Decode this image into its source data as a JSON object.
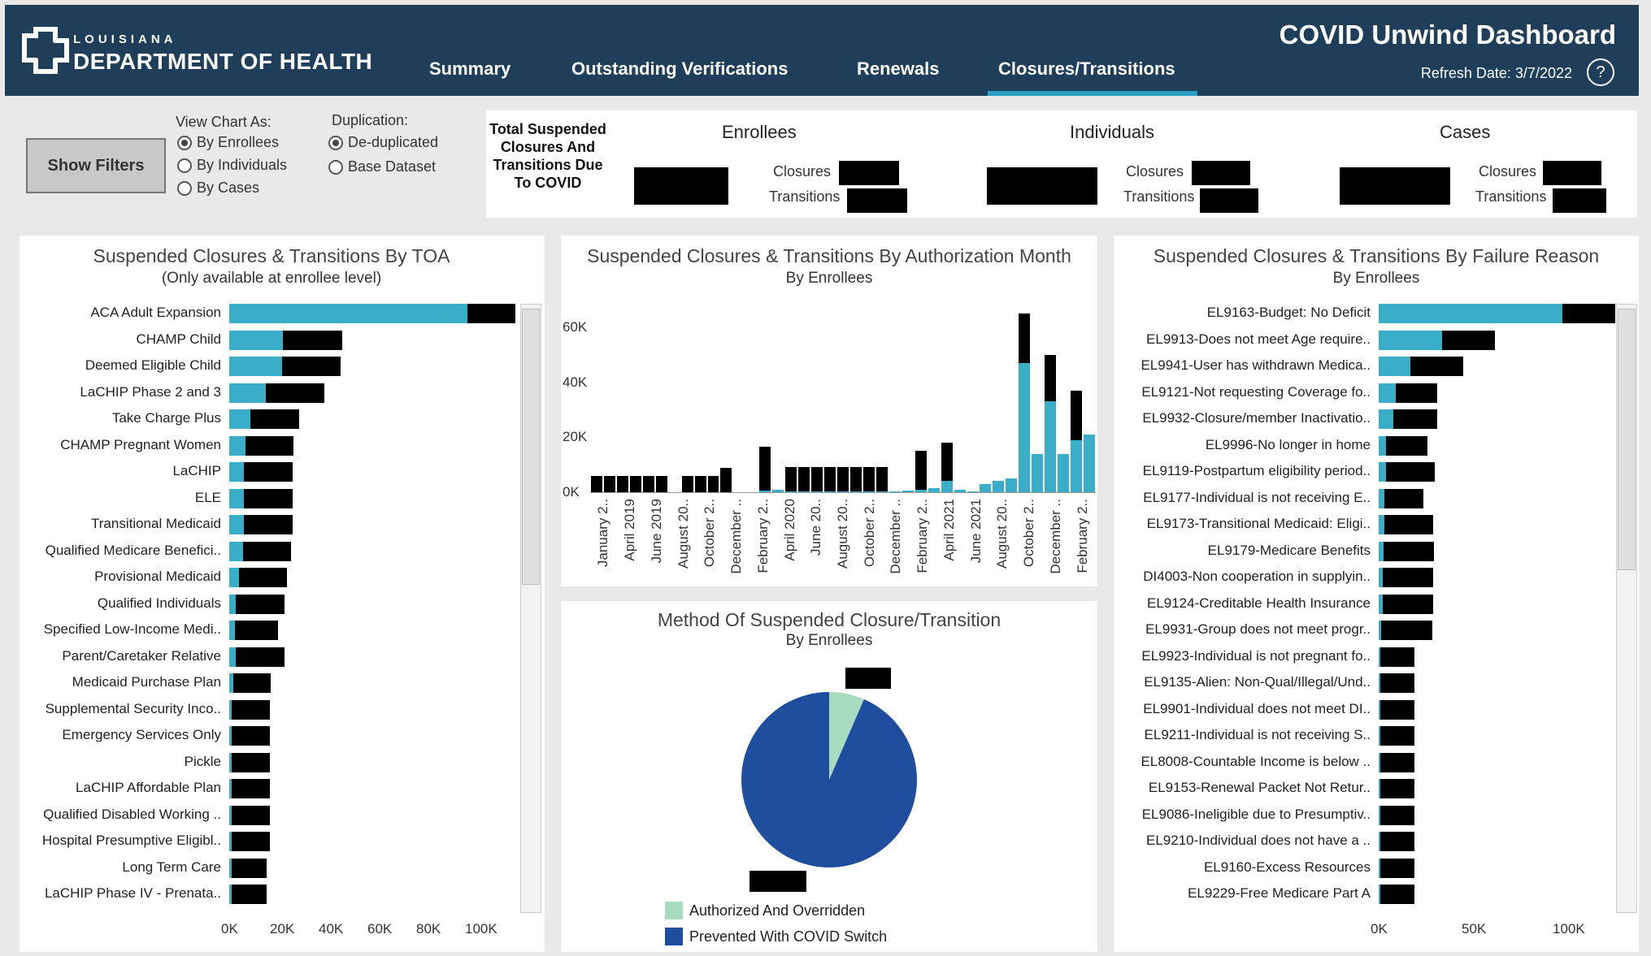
{
  "header": {
    "logo_small": "LOUISIANA",
    "logo_big": "DEPARTMENT OF HEALTH",
    "tabs": [
      "Summary",
      "Outstanding Verifications",
      "Renewals",
      "Closures/Transitions"
    ],
    "title": "COVID Unwind Dashboard",
    "refresh": "Refresh Date: 3/7/2022",
    "help": "?"
  },
  "filters": {
    "button": "Show Filters",
    "view_title": "View Chart As:",
    "view_options": [
      "By Enrollees",
      "By Individuals",
      "By Cases"
    ],
    "view_selected": 0,
    "dup_title": "Duplication:",
    "dup_options": [
      "De-duplicated",
      "Base Dataset"
    ],
    "dup_selected": 0
  },
  "totals": {
    "label": "Total Suspended Closures And Transitions Due To COVID",
    "groups": [
      "Enrollees",
      "Individuals",
      "Cases"
    ],
    "closures_label": "Closures",
    "transitions_label": "Transitions"
  },
  "colors": {
    "teal": "#3aaec8",
    "black": "#000000",
    "green": "#a8dcc0",
    "blue": "#1f4e9e",
    "header": "#1e3e5a"
  },
  "toa_panel": {
    "title": "Suspended Closures & Transitions By TOA",
    "subtitle": "(Only available at enrollee level)",
    "chart_data": {
      "type": "bar",
      "orientation": "horizontal",
      "stacked": true,
      "categories": [
        "ACA Adult Expansion",
        "CHAMP Child",
        "Deemed Eligible Child",
        "LaCHIP Phase 2 and 3",
        "Take Charge Plus",
        "CHAMP Pregnant Women",
        "LaCHIP",
        "ELE",
        "Transitional Medicaid",
        "Qualified Medicare Benefici..",
        "Provisional Medicaid",
        "Qualified Individuals",
        "Specified Low-Income Medi..",
        "Parent/Caretaker Relative",
        "Medicaid Purchase Plan",
        "Supplemental Security Inco..",
        "Emergency Services Only",
        "Pickle",
        "LaCHIP Affordable Plan",
        "Qualified Disabled Working ..",
        "Hospital Presumptive Eligibl..",
        "Long Term Care",
        "LaCHIP Phase IV - Prenata.."
      ],
      "series": [
        {
          "values": [
            88500,
            20000,
            19500,
            13500,
            8000,
            6000,
            5500,
            5500,
            5500,
            5000,
            3500,
            2500,
            2000,
            2500,
            1500,
            1000,
            1000,
            1000,
            1000,
            1000,
            1000,
            1000,
            1000
          ]
        },
        {
          "values": [
            18000,
            22000,
            22000,
            22000,
            18000,
            18000,
            18000,
            18000,
            18000,
            18000,
            18000,
            18000,
            16000,
            18000,
            14000,
            14000,
            14000,
            14000,
            14000,
            14000,
            14000,
            13000,
            13000
          ]
        }
      ],
      "xticks": [
        "0K",
        "20K",
        "40K",
        "60K",
        "80K",
        "100K"
      ],
      "xlim": [
        0,
        110000
      ]
    }
  },
  "month_panel": {
    "title": "Suspended Closures & Transitions By Authorization Month",
    "subtitle": "By Enrollees",
    "chart_data": {
      "type": "bar",
      "stacked": true,
      "categories": [
        "January 2019",
        "February 2019",
        "March 2019",
        "April 2019",
        "May 2019",
        "June 2019",
        "July 2019",
        "August 2019",
        "September 2019",
        "October 2019",
        "November 2019",
        "December 2019",
        "January 2020",
        "February 2020",
        "March 2020",
        "April 2020",
        "May 2020",
        "June 2020",
        "July 2020",
        "August 2020",
        "September 2020",
        "October 2020",
        "November 2020",
        "December 2020",
        "January 2021",
        "February 2021",
        "March 2021",
        "April 2021",
        "May 2021",
        "June 2021",
        "July 2021",
        "August 2021",
        "September 2021",
        "October 2021",
        "November 2021",
        "December 2021",
        "January 2022",
        "February 2022",
        "March 2022"
      ],
      "series": [
        {
          "values": [
            0,
            0,
            0,
            0,
            0,
            0,
            0,
            0,
            0,
            0,
            0,
            0,
            0,
            500,
            1000,
            200,
            200,
            200,
            200,
            200,
            200,
            200,
            200,
            200,
            500,
            1000,
            1500,
            4000,
            1000,
            200,
            3000,
            4000,
            5000,
            47000,
            14000,
            33000,
            14000,
            19000,
            21000
          ]
        },
        {
          "values": [
            6000,
            6000,
            6000,
            6000,
            6000,
            6000,
            0,
            6000,
            6000,
            6000,
            9000,
            0,
            0,
            16000,
            0,
            9000,
            9000,
            9000,
            9000,
            9000,
            9000,
            9000,
            9000,
            0,
            0,
            14000,
            0,
            14000,
            0,
            0,
            0,
            0,
            0,
            18000,
            0,
            17000,
            0,
            18000,
            0
          ]
        }
      ],
      "xticks": [
        "January 2..",
        "April 2019",
        "June 2019",
        "August 20..",
        "October 2..",
        "December ..",
        "February 2..",
        "April 2020",
        "June 20..",
        "August 20..",
        "October 2..",
        "December ..",
        "February 2..",
        "April 2021",
        "June 2021",
        "August 20..",
        "October 2..",
        "December ..",
        "February 2.."
      ],
      "yticks": [
        "0K",
        "20K",
        "40K",
        "60K"
      ],
      "ylim": [
        0,
        65000
      ]
    }
  },
  "method_panel": {
    "title": "Method Of Suspended Closure/Transition",
    "subtitle": "By Enrollees",
    "chart_data": {
      "type": "pie",
      "labels": [
        "Authorized And Overridden",
        "Prevented With COVID Switch"
      ],
      "values": [
        0.065,
        0.935
      ]
    }
  },
  "failure_panel": {
    "title": "Suspended Closures & Transitions By Failure Reason",
    "subtitle": "By Enrollees",
    "chart_data": {
      "type": "bar",
      "orientation": "horizontal",
      "stacked": true,
      "categories": [
        "EL9163-Budget: No Deficit",
        "EL9913-Does not meet Age require..",
        "EL9941-User has withdrawn Medica..",
        "EL9121-Not requesting Coverage fo..",
        "EL9932-Closure/member Inactivatio..",
        "EL9996-No longer in home",
        "EL9119-Postpartum eligibility period..",
        "EL9177-Individual is not receiving E..",
        "EL9173-Transitional Medicaid: Eligi..",
        "EL9179-Medicare Benefits",
        "DI4003-Non cooperation in supplyin..",
        "EL9124-Creditable Health Insurance",
        "EL9931-Group does not meet progr..",
        "EL9923-Individual is not pregnant fo..",
        "EL9135-Alien: Non-Qual/Illegal/Und..",
        "EL9901-Individual does not meet DI..",
        "EL9211-Individual is not receiving S..",
        "EL8008-Countable Income is below ..",
        "EL9153-Renewal Packet Not Retur..",
        "EL9086-Ineligible due to Presumptiv..",
        "EL9210-Individual does not have a ..",
        "EL9160-Excess Resources",
        "EL9229-Free Medicare Part A"
      ],
      "series": [
        {
          "values": [
            98000,
            34000,
            17000,
            9000,
            8000,
            4000,
            4000,
            3000,
            3000,
            2500,
            2000,
            2000,
            1500,
            1000,
            1000,
            1000,
            1000,
            1000,
            1000,
            1000,
            1000,
            1000,
            1000
          ]
        },
        {
          "values": [
            28000,
            28000,
            28000,
            22000,
            23000,
            22000,
            26000,
            21000,
            26000,
            27000,
            27000,
            27000,
            27000,
            18000,
            18000,
            18000,
            18000,
            18000,
            18000,
            18000,
            18000,
            18000,
            18000
          ]
        }
      ],
      "xticks": [
        "0K",
        "50K",
        "100K"
      ],
      "xlim": [
        0,
        130000
      ]
    }
  }
}
